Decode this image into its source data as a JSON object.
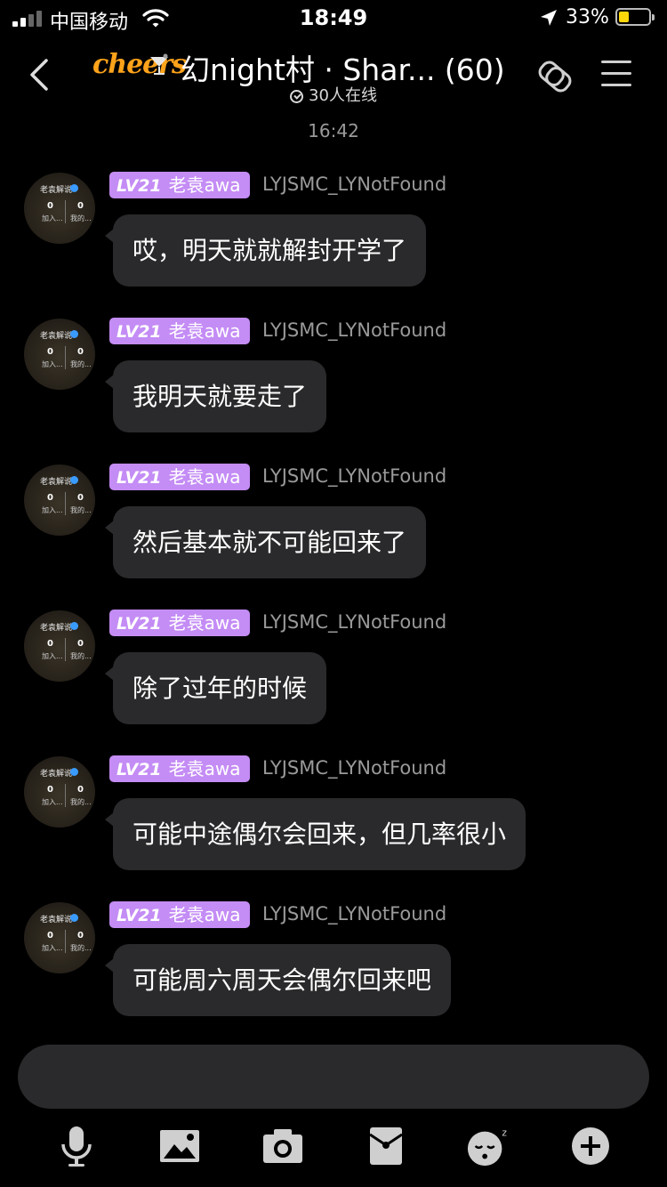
{
  "status_bar": {
    "carrier": "中国移动",
    "time": "18:49",
    "battery": "33%",
    "battery_level": 0.33
  },
  "header": {
    "logo_text": "cheers",
    "title": "幻night村 · Shar... (60)",
    "online_text": "30人在线"
  },
  "chat": {
    "timestamp": "16:42",
    "messages": [
      {
        "level": "LV21",
        "nickname": "老袁awa",
        "username": "LYJSMC_LYNotFound",
        "avatar": {
          "name": "老袁解说",
          "count1": "0",
          "count2": "0",
          "label1": "加入...",
          "label2": "我的..."
        },
        "text": "哎，明天就就解封开学了"
      },
      {
        "level": "LV21",
        "nickname": "老袁awa",
        "username": "LYJSMC_LYNotFound",
        "avatar": {
          "name": "老袁解说",
          "count1": "0",
          "count2": "0",
          "label1": "加入...",
          "label2": "我的..."
        },
        "text": "我明天就要走了"
      },
      {
        "level": "LV21",
        "nickname": "老袁awa",
        "username": "LYJSMC_LYNotFound",
        "avatar": {
          "name": "老袁解说",
          "count1": "0",
          "count2": "0",
          "label1": "加入...",
          "label2": "我的..."
        },
        "text": "然后基本就不可能回来了"
      },
      {
        "level": "LV21",
        "nickname": "老袁awa",
        "username": "LYJSMC_LYNotFound",
        "avatar": {
          "name": "老袁解说",
          "count1": "0",
          "count2": "0",
          "label1": "加入...",
          "label2": "我的..."
        },
        "text": "除了过年的时候"
      },
      {
        "level": "LV21",
        "nickname": "老袁awa",
        "username": "LYJSMC_LYNotFound",
        "avatar": {
          "name": "老袁解说",
          "count1": "0",
          "count2": "0",
          "label1": "加入...",
          "label2": "我的..."
        },
        "text": "可能中途偶尔会回来，但几率很小"
      },
      {
        "level": "LV21",
        "nickname": "老袁awa",
        "username": "LYJSMC_LYNotFound",
        "avatar": {
          "name": "老袁解说",
          "count1": "0",
          "count2": "0",
          "label1": "加入...",
          "label2": "我的..."
        },
        "text": "可能周六周天会偶尔回来吧"
      }
    ]
  },
  "input": {
    "value": "",
    "placeholder": ""
  },
  "toolbar": {
    "icons": [
      "microphone-icon",
      "image-icon",
      "camera-icon",
      "red-packet-icon",
      "emoji-icon",
      "plus-icon"
    ]
  },
  "colors": {
    "background": "#000000",
    "bubble": "#2a2a2c",
    "level_badge": "#c48cf5",
    "logo": "#ffa31a",
    "battery": "#ffd60a",
    "meta_text": "#9a9a9a"
  }
}
